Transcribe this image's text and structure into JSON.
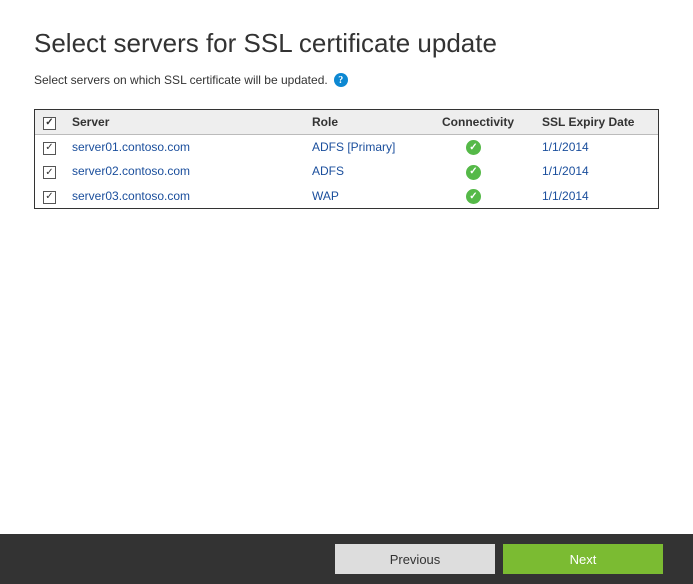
{
  "title": "Select servers for SSL certificate update",
  "subtitle": "Select servers on which SSL certificate will be updated.",
  "table": {
    "headers": {
      "server": "Server",
      "role": "Role",
      "connectivity": "Connectivity",
      "expiry": "SSL Expiry Date"
    },
    "rows": [
      {
        "checked": true,
        "server": "server01.contoso.com",
        "role": "ADFS [Primary]",
        "connectivity": "ok",
        "expiry": "1/1/2014"
      },
      {
        "checked": true,
        "server": "server02.contoso.com",
        "role": "ADFS",
        "connectivity": "ok",
        "expiry": "1/1/2014"
      },
      {
        "checked": true,
        "server": "server03.contoso.com",
        "role": "WAP",
        "connectivity": "ok",
        "expiry": "1/1/2014"
      }
    ]
  },
  "buttons": {
    "previous": "Previous",
    "next": "Next"
  }
}
